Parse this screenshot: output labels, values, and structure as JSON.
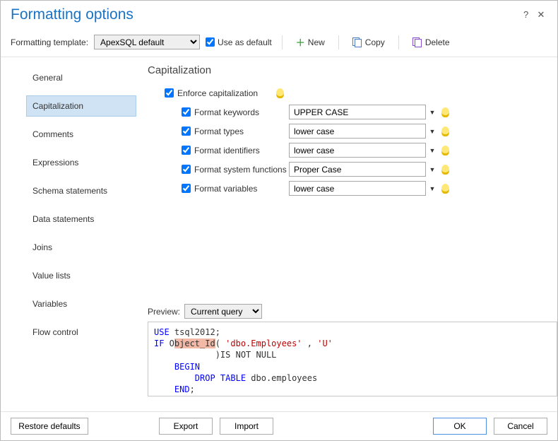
{
  "title": "Formatting options",
  "toolbar": {
    "template_label": "Formatting template:",
    "template_value": "ApexSQL default",
    "use_as_default": "Use as default",
    "new_label": "New",
    "copy_label": "Copy",
    "delete_label": "Delete"
  },
  "sidebar": {
    "items": [
      {
        "label": "General"
      },
      {
        "label": "Capitalization"
      },
      {
        "label": "Comments"
      },
      {
        "label": "Expressions"
      },
      {
        "label": "Schema statements"
      },
      {
        "label": "Data statements"
      },
      {
        "label": "Joins"
      },
      {
        "label": "Value lists"
      },
      {
        "label": "Variables"
      },
      {
        "label": "Flow control"
      }
    ],
    "selected_index": 1
  },
  "panel": {
    "heading": "Capitalization",
    "enforce_label": "Enforce capitalization",
    "rows": [
      {
        "label": "Format keywords",
        "value": "UPPER CASE"
      },
      {
        "label": "Format types",
        "value": "lower case"
      },
      {
        "label": "Format identifiers",
        "value": "lower case"
      },
      {
        "label": "Format system functions",
        "value": "Proper Case"
      },
      {
        "label": "Format variables",
        "value": "lower case"
      }
    ]
  },
  "preview": {
    "label": "Preview:",
    "mode": "Current query",
    "code": {
      "l1a": "USE",
      "l1b": " tsql2012;",
      "l2a": "IF",
      "l2b": " O",
      "l2hl": "bject_Id",
      "l2c": "( ",
      "l2d": "'dbo.Employees'",
      "l2e": " , ",
      "l2f": "'U'",
      "l3a": "            )IS NOT NULL",
      "l4a": "    BEGIN",
      "l5a": "        DROP TABLE",
      "l5b": " dbo.employees",
      "l6a": "    END",
      "l6b": ";"
    }
  },
  "footer": {
    "restore": "Restore defaults",
    "export": "Export",
    "import": "Import",
    "ok": "OK",
    "cancel": "Cancel"
  }
}
